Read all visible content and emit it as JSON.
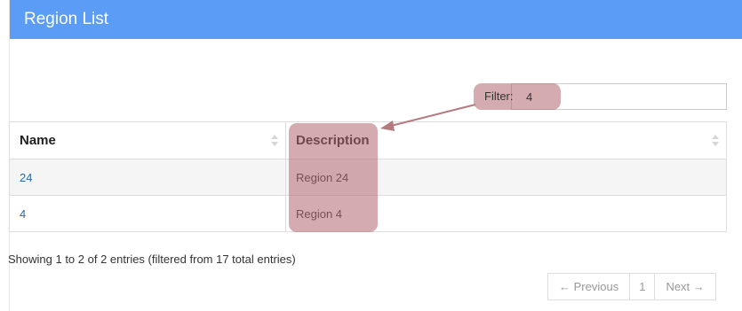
{
  "panel": {
    "title": "Region List"
  },
  "filter": {
    "label": "Filter:",
    "value": "4"
  },
  "table": {
    "columns": [
      "Name",
      "Description"
    ],
    "rows": [
      {
        "name": "24",
        "description": "Region 24"
      },
      {
        "name": "4",
        "description": "Region 4"
      }
    ]
  },
  "info": "Showing 1 to 2 of 2 entries (filtered from 17 total entries)",
  "pagination": {
    "previous": "← Previous",
    "current": "1",
    "next": "Next →"
  },
  "colors": {
    "header": "#5b9cf7",
    "highlight": "#b0686e",
    "link": "#2a6aa8"
  },
  "icons": {
    "sort": "sort-both-icon",
    "arrow": "annotation-arrow"
  }
}
